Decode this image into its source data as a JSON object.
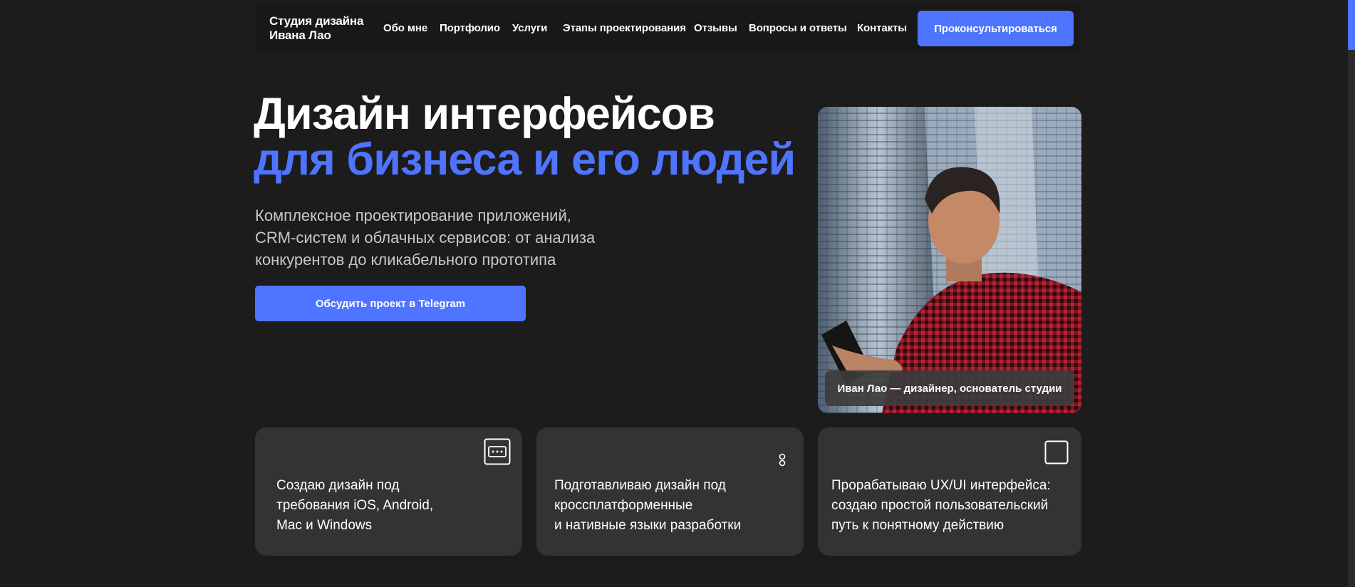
{
  "header": {
    "logo": "Студия дизайна\nИвана Лао",
    "nav": [
      {
        "label": "Обо мне"
      },
      {
        "label": "Портфолио"
      },
      {
        "label": "Услуги"
      },
      {
        "label": "Этапы проектирования"
      },
      {
        "label": "Отзывы"
      },
      {
        "label": "Вопросы и ответы"
      },
      {
        "label": "Контакты"
      }
    ],
    "cta_label": "Проконсультироваться"
  },
  "hero": {
    "title_line1": "Дизайн интерфейсов",
    "title_line2": "для бизнеса и его людей",
    "subtitle": "Комплексное проектирование приложений,\nCRM-систем и облачных сервисов: от анализа\nконкурентов до кликабельного прототипа",
    "cta_label": "Обсудить проект в Telegram",
    "photo_caption": "Иван Лао — дизайнер, основатель студии"
  },
  "cards": [
    {
      "text": "Создаю дизайн под\nтребования iOS, Android,\nMac и Windows",
      "icon": "window-dots-icon"
    },
    {
      "text": "Подготавливаю дизайн под\nкроссплатформенные\nи нативные языки разработки",
      "icon": "link-chain-icon"
    },
    {
      "text": "Прорабатываю UX/UI интерфейса:\nсоздаю простой пользовательский\nпуть к понятному действию",
      "icon": "square-icon"
    }
  ],
  "colors": {
    "accent": "#4f74ff",
    "background": "#1c1c1c",
    "card": "#333333"
  }
}
